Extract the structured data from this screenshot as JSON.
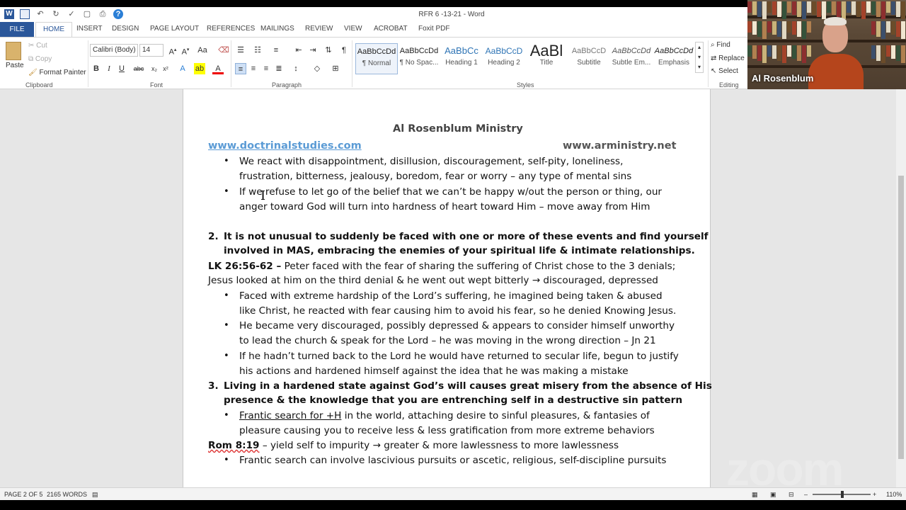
{
  "window": {
    "title": "RFR 6 -13-21 - Word",
    "quick_access": [
      "word-icon",
      "save-icon",
      "undo-icon",
      "redo-icon",
      "spellcheck-icon",
      "print-preview-icon",
      "print-icon",
      "help-icon"
    ]
  },
  "tabs": [
    "FILE",
    "HOME",
    "INSERT",
    "DESIGN",
    "PAGE LAYOUT",
    "REFERENCES",
    "MAILINGS",
    "REVIEW",
    "VIEW",
    "ACROBAT",
    "Foxit PDF"
  ],
  "ribbon": {
    "clipboard": {
      "paste": "Paste",
      "cut": "Cut",
      "copy": "Copy",
      "format_painter": "Format Painter",
      "label": "Clipboard"
    },
    "font": {
      "family": "Calibri (Body)",
      "size": "14",
      "label": "Font"
    },
    "paragraph": {
      "label": "Paragraph"
    },
    "styles": {
      "label": "Styles",
      "items": [
        {
          "sample": "AaBbCcDd",
          "name": "¶ Normal"
        },
        {
          "sample": "AaBbCcDd",
          "name": "¶ No Spac..."
        },
        {
          "sample": "AaBbCc",
          "name": "Heading 1"
        },
        {
          "sample": "AaBbCcD",
          "name": "Heading 2"
        },
        {
          "sample": "AaBl",
          "name": "Title"
        },
        {
          "sample": "AaBbCcD",
          "name": "Subtitle"
        },
        {
          "sample": "AaBbCcDd",
          "name": "Subtle Em..."
        },
        {
          "sample": "AaBbCcDd",
          "name": "Emphasis"
        }
      ]
    },
    "editing": {
      "find": "Find",
      "replace": "Replace",
      "select": "Select",
      "label": "Editing"
    }
  },
  "document": {
    "header_title": "Al Rosenblum Ministry",
    "link_left": "www.doctrinalstudies.com",
    "link_right": "www.arministry.net",
    "lines": [
      {
        "bullet": true,
        "text": "We react with disappointment, disillusion, discouragement, self-pity, loneliness,"
      },
      {
        "text": "frustration, bitterness, jealousy, boredom, fear or worry – any type of mental sins"
      },
      {
        "bullet": true,
        "text": "If we refuse to let go of the belief that we can’t be happy w/out the person or thing, our"
      },
      {
        "text": "anger toward God will turn into hardness of heart toward Him – move away from Him"
      },
      {
        "num": "2.",
        "bold": true,
        "text": "It is not unusual to suddenly be faced with one or more of these events and find yourself"
      },
      {
        "bold": true,
        "text": "involved in MAS, embracing the enemies of your spiritual life & intimate relationships."
      },
      {
        "ref": "LK 26:56-62 –",
        "text": " Peter faced with the fear of sharing the suffering of Christ chose to the 3 denials;"
      },
      {
        "text": "Jesus looked at him on the third denial & he went out wept bitterly → discouraged, depressed"
      },
      {
        "bullet": true,
        "text": "Faced with extreme hardship of the Lord’s suffering, he imagined being taken & abused"
      },
      {
        "text": "like Christ, he reacted with fear causing him to avoid his fear, so he denied Knowing Jesus."
      },
      {
        "bullet": true,
        "text": "He became very discouraged, possibly depressed & appears to consider himself unworthy"
      },
      {
        "text": "to lead the church & speak for the Lord – he was moving in the wrong direction – Jn 21"
      },
      {
        "bullet": true,
        "text": "If he hadn’t turned back to the Lord he would have returned to secular life, begun to justify"
      },
      {
        "text": "his actions and hardened himself against the idea that he was making a mistake"
      },
      {
        "num": "3.",
        "bold": true,
        "text": "Living in a hardened state against God’s will causes great misery from the absence of His"
      },
      {
        "bold": true,
        "text": "presence & the knowledge that you are entrenching self in a destructive sin pattern"
      },
      {
        "bullet": true,
        "underline": "Frantic search for +H",
        "text": " in the world, attaching desire to sinful pleasures, & fantasies of"
      },
      {
        "text": "pleasure causing you to receive less & less gratification from more extreme behaviors"
      },
      {
        "ref": "Rom 8:19",
        "text": " – yield self to impurity → greater & more lawlessness to more lawlessness"
      },
      {
        "bullet": true,
        "text": "Frantic search can involve lascivious pursuits or ascetic, religious, self-discipline pursuits"
      }
    ]
  },
  "status": {
    "page": "PAGE 2 OF 5",
    "words": "2165 WORDS",
    "zoom": "110%"
  },
  "video": {
    "participant": "Al Rosenblum",
    "watermark": "zoom"
  }
}
